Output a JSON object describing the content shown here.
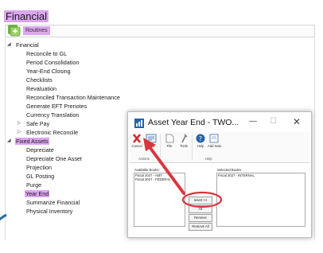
{
  "app": {
    "title": "Financial"
  },
  "routines": {
    "label": "Routines",
    "icon": "routines-icon"
  },
  "tree": {
    "financial": {
      "label": "Financial",
      "items": [
        "Reconcile to GL",
        "Period Consolidation",
        "Year-End Closing",
        "Checklists",
        "Revaluation",
        "Reconciled Transaction Maintenance",
        "Generate EFT Prenotes",
        "Currency Translation"
      ],
      "safe_pay": "Safe Pay",
      "electronic_reconcile": "Electronic Reconcile"
    },
    "fixed_assets": {
      "label": "Fixed Assets",
      "items": [
        "Depreciate",
        "Depreciate One Asset",
        "Projection",
        "GL Posting",
        "Purge",
        "Year End",
        "Summarize Financial",
        "Physical Inventory"
      ]
    }
  },
  "dialog": {
    "title": "Asset Year End  -  TWO...",
    "window_buttons": {
      "minimize": "—",
      "maximize": "☐",
      "close": "✕"
    },
    "ribbon": {
      "cancel": "Cancel",
      "continue": "Contin...",
      "file": "File",
      "tools": "Tools",
      "help": "Help",
      "add_note": "Add Note",
      "actions_group": "Actions",
      "help_group": "Help"
    },
    "available_books": {
      "label": "Available Books:",
      "items": [
        "Fiscal 2027 - AMT",
        "Fiscal 2027 - FEDERAL"
      ]
    },
    "selected_books": {
      "label": "Selected Books:",
      "items": [
        "Fiscal 2027 - INTERNAL"
      ]
    },
    "buttons": {
      "insert": "Insert >>",
      "all": "All",
      "remove": "Remove",
      "remove_all": "Remove All"
    }
  },
  "colors": {
    "highlight": "#dca6ef",
    "annotation": "#d9363e",
    "title_bar_icon": "#2463a8"
  }
}
